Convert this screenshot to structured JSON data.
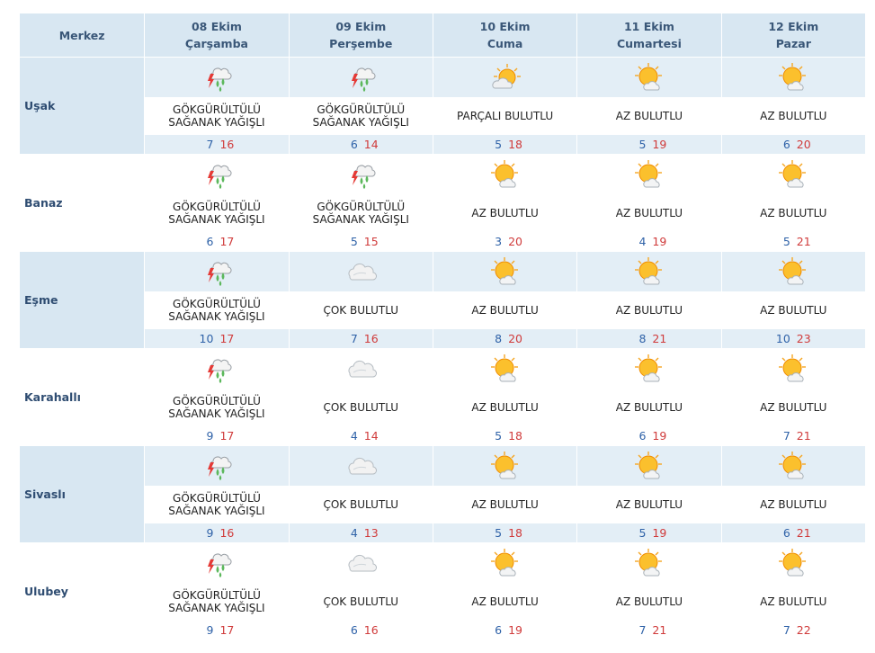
{
  "header": {
    "merkez": "Merkez",
    "days": [
      {
        "date": "08 Ekim",
        "name": "Çarşamba"
      },
      {
        "date": "09 Ekim",
        "name": "Perşembe"
      },
      {
        "date": "10 Ekim",
        "name": "Cuma"
      },
      {
        "date": "11 Ekim",
        "name": "Cumartesi"
      },
      {
        "date": "12 Ekim",
        "name": "Pazar"
      }
    ]
  },
  "cities": [
    {
      "name": "Uşak",
      "days": [
        {
          "icon": "thunderstorm-icon",
          "desc": [
            "GÖKGÜRÜLTÜLÜ",
            "SAĞANAK YAĞIŞLI"
          ],
          "min": "7",
          "max": "16"
        },
        {
          "icon": "thunderstorm-icon",
          "desc": [
            "GÖKGÜRÜLTÜLÜ",
            "SAĞANAK YAĞIŞLI"
          ],
          "min": "6",
          "max": "14"
        },
        {
          "icon": "partly-cloudy-icon",
          "desc": [
            "PARÇALI BULUTLU"
          ],
          "min": "5",
          "max": "18"
        },
        {
          "icon": "mostly-sunny-icon",
          "desc": [
            "AZ BULUTLU"
          ],
          "min": "5",
          "max": "19"
        },
        {
          "icon": "mostly-sunny-icon",
          "desc": [
            "AZ BULUTLU"
          ],
          "min": "6",
          "max": "20"
        }
      ]
    },
    {
      "name": "Banaz",
      "days": [
        {
          "icon": "thunderstorm-icon",
          "desc": [
            "GÖKGÜRÜLTÜLÜ",
            "SAĞANAK YAĞIŞLI"
          ],
          "min": "6",
          "max": "17"
        },
        {
          "icon": "thunderstorm-icon",
          "desc": [
            "GÖKGÜRÜLTÜLÜ",
            "SAĞANAK YAĞIŞLI"
          ],
          "min": "5",
          "max": "15"
        },
        {
          "icon": "mostly-sunny-icon",
          "desc": [
            "AZ BULUTLU"
          ],
          "min": "3",
          "max": "20"
        },
        {
          "icon": "mostly-sunny-icon",
          "desc": [
            "AZ BULUTLU"
          ],
          "min": "4",
          "max": "19"
        },
        {
          "icon": "mostly-sunny-icon",
          "desc": [
            "AZ BULUTLU"
          ],
          "min": "5",
          "max": "21"
        }
      ]
    },
    {
      "name": "Eşme",
      "days": [
        {
          "icon": "thunderstorm-icon",
          "desc": [
            "GÖKGÜRÜLTÜLÜ",
            "SAĞANAK YAĞIŞLI"
          ],
          "min": "10",
          "max": "17"
        },
        {
          "icon": "cloudy-icon",
          "desc": [
            "ÇOK BULUTLU"
          ],
          "min": "7",
          "max": "16"
        },
        {
          "icon": "mostly-sunny-icon",
          "desc": [
            "AZ BULUTLU"
          ],
          "min": "8",
          "max": "20"
        },
        {
          "icon": "mostly-sunny-icon",
          "desc": [
            "AZ BULUTLU"
          ],
          "min": "8",
          "max": "21"
        },
        {
          "icon": "mostly-sunny-icon",
          "desc": [
            "AZ BULUTLU"
          ],
          "min": "10",
          "max": "23"
        }
      ]
    },
    {
      "name": "Karahallı",
      "days": [
        {
          "icon": "thunderstorm-icon",
          "desc": [
            "GÖKGÜRÜLTÜLÜ",
            "SAĞANAK YAĞIŞLI"
          ],
          "min": "9",
          "max": "17"
        },
        {
          "icon": "cloudy-icon",
          "desc": [
            "ÇOK BULUTLU"
          ],
          "min": "4",
          "max": "14"
        },
        {
          "icon": "mostly-sunny-icon",
          "desc": [
            "AZ BULUTLU"
          ],
          "min": "5",
          "max": "18"
        },
        {
          "icon": "mostly-sunny-icon",
          "desc": [
            "AZ BULUTLU"
          ],
          "min": "6",
          "max": "19"
        },
        {
          "icon": "mostly-sunny-icon",
          "desc": [
            "AZ BULUTLU"
          ],
          "min": "7",
          "max": "21"
        }
      ]
    },
    {
      "name": "Sivaslı",
      "days": [
        {
          "icon": "thunderstorm-icon",
          "desc": [
            "GÖKGÜRÜLTÜLÜ",
            "SAĞANAK YAĞIŞLI"
          ],
          "min": "9",
          "max": "16"
        },
        {
          "icon": "cloudy-icon",
          "desc": [
            "ÇOK BULUTLU"
          ],
          "min": "4",
          "max": "13"
        },
        {
          "icon": "mostly-sunny-icon",
          "desc": [
            "AZ BULUTLU"
          ],
          "min": "5",
          "max": "18"
        },
        {
          "icon": "mostly-sunny-icon",
          "desc": [
            "AZ BULUTLU"
          ],
          "min": "5",
          "max": "19"
        },
        {
          "icon": "mostly-sunny-icon",
          "desc": [
            "AZ BULUTLU"
          ],
          "min": "6",
          "max": "21"
        }
      ]
    },
    {
      "name": "Ulubey",
      "days": [
        {
          "icon": "thunderstorm-icon",
          "desc": [
            "GÖKGÜRÜLTÜLÜ",
            "SAĞANAK YAĞIŞLI"
          ],
          "min": "9",
          "max": "17"
        },
        {
          "icon": "cloudy-icon",
          "desc": [
            "ÇOK BULUTLU"
          ],
          "min": "6",
          "max": "16"
        },
        {
          "icon": "mostly-sunny-icon",
          "desc": [
            "AZ BULUTLU"
          ],
          "min": "6",
          "max": "19"
        },
        {
          "icon": "mostly-sunny-icon",
          "desc": [
            "AZ BULUTLU"
          ],
          "min": "7",
          "max": "21"
        },
        {
          "icon": "mostly-sunny-icon",
          "desc": [
            "AZ BULUTLU"
          ],
          "min": "7",
          "max": "22"
        }
      ]
    }
  ],
  "colors": {
    "header_bg": "#d8e7f2",
    "header_text": "#3a5778",
    "row_tint": "#e3eef6",
    "min_temp": "#2f62a8",
    "max_temp": "#d03b3b"
  }
}
